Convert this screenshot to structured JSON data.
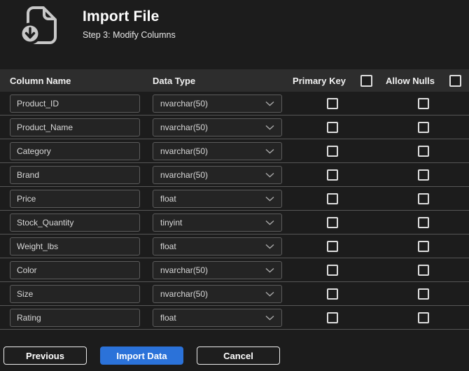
{
  "header": {
    "title": "Import File",
    "subtitle": "Step 3: Modify Columns",
    "icon": "file-download-icon"
  },
  "table": {
    "headers": {
      "name": "Column Name",
      "data_type": "Data Type",
      "primary_key": "Primary Key",
      "allow_nulls": "Allow Nulls"
    },
    "select_all_primary_key_checked": false,
    "select_all_allow_nulls_checked": false,
    "rows": [
      {
        "name": "Product_ID",
        "data_type": "nvarchar(50)",
        "primary_key": false,
        "allow_nulls": false
      },
      {
        "name": "Product_Name",
        "data_type": "nvarchar(50)",
        "primary_key": false,
        "allow_nulls": false
      },
      {
        "name": "Category",
        "data_type": "nvarchar(50)",
        "primary_key": false,
        "allow_nulls": false
      },
      {
        "name": "Brand",
        "data_type": "nvarchar(50)",
        "primary_key": false,
        "allow_nulls": false
      },
      {
        "name": "Price",
        "data_type": "float",
        "primary_key": false,
        "allow_nulls": false
      },
      {
        "name": "Stock_Quantity",
        "data_type": "tinyint",
        "primary_key": false,
        "allow_nulls": false
      },
      {
        "name": "Weight_lbs",
        "data_type": "float",
        "primary_key": false,
        "allow_nulls": false
      },
      {
        "name": "Color",
        "data_type": "nvarchar(50)",
        "primary_key": false,
        "allow_nulls": false
      },
      {
        "name": "Size",
        "data_type": "nvarchar(50)",
        "primary_key": false,
        "allow_nulls": false
      },
      {
        "name": "Rating",
        "data_type": "float",
        "primary_key": false,
        "allow_nulls": false
      }
    ]
  },
  "footer": {
    "previous": "Previous",
    "import": "Import Data",
    "cancel": "Cancel"
  },
  "colors": {
    "accent_blue": "#2b72d9",
    "header_band": "#2d2d2d",
    "background": "#1c1c1c",
    "row_separator": "#565656"
  }
}
